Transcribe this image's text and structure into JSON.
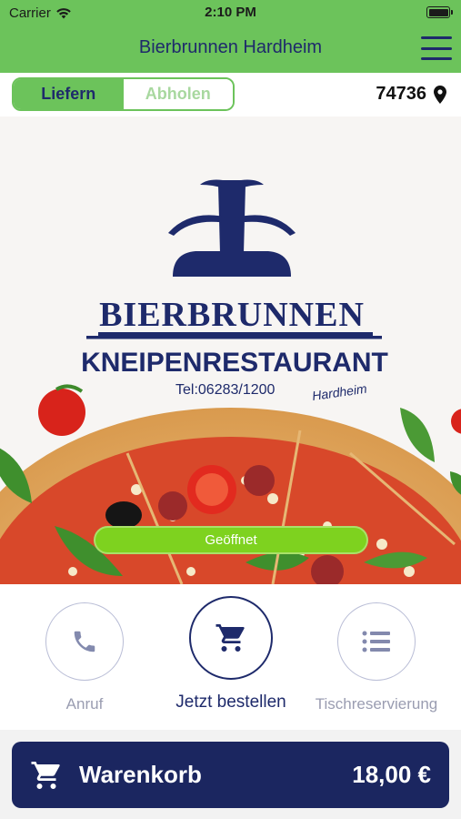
{
  "status_bar": {
    "carrier": "Carrier",
    "time": "2:10 PM"
  },
  "nav": {
    "title": "Bierbrunnen Hardheim"
  },
  "mode_toggle": {
    "deliver": "Liefern",
    "pickup": "Abholen",
    "selected": "Liefern"
  },
  "location": {
    "zip": "74736"
  },
  "hero": {
    "logo_line1": "BIERBRUNNEN",
    "logo_line2": "KNEIPENRESTAURANT",
    "logo_phone": "Tel:06283/1200",
    "logo_town": "Hardheim",
    "status": "Geöffnet"
  },
  "actions": {
    "call": "Anruf",
    "order": "Jetzt bestellen",
    "reservation": "Tischreservierung"
  },
  "cart": {
    "label": "Warenkorb",
    "total": "18,00 €"
  },
  "colors": {
    "green": "#6cc35b",
    "navy": "#1e2a6b",
    "open": "#7ed21f",
    "cart_bg": "#1b2660"
  }
}
